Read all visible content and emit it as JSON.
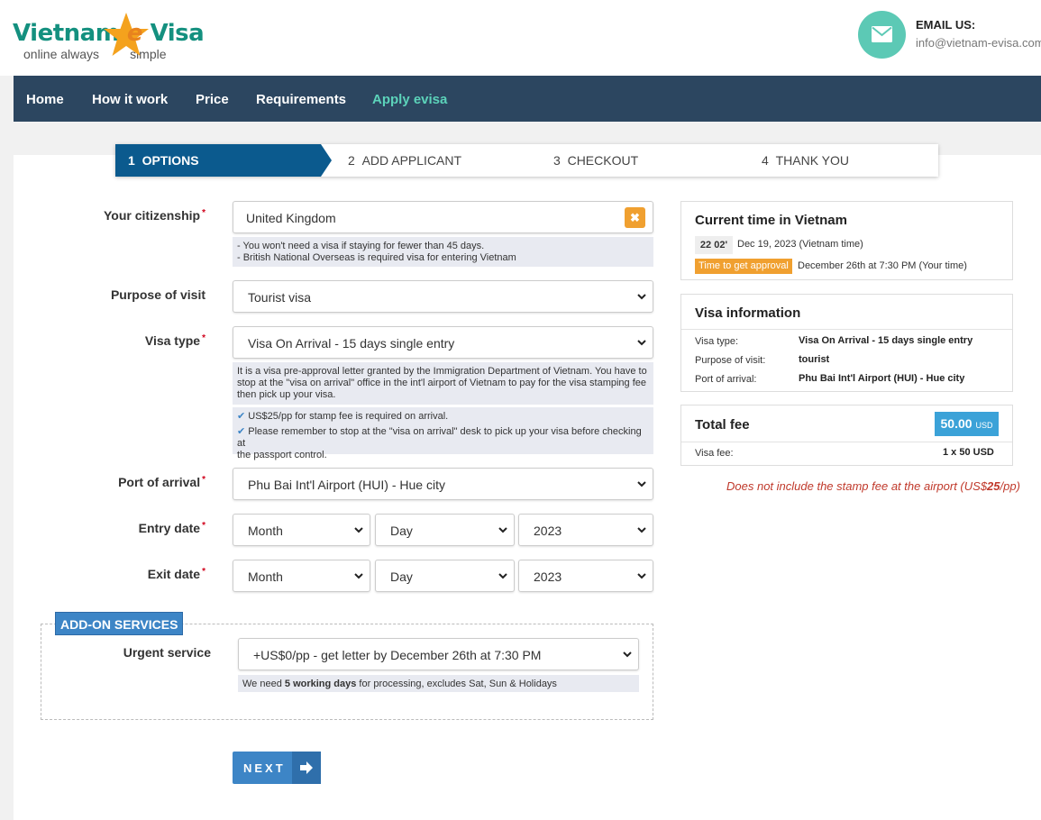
{
  "header": {
    "logo_word1": "Vietnam",
    "logo_e": "e",
    "logo_word2": "Visa",
    "logo_tag1": "online always",
    "logo_tag2": "simple",
    "email_label": "EMAIL US:",
    "email_value": "info@vietnam-evisa.com"
  },
  "nav": {
    "items": [
      "Home",
      "How it work",
      "Price",
      "Requirements",
      "Apply evisa"
    ],
    "active": "Apply evisa"
  },
  "steps": [
    {
      "num": "1",
      "label": "OPTIONS",
      "active": true
    },
    {
      "num": "2",
      "label": "ADD APPLICANT"
    },
    {
      "num": "3",
      "label": "CHECKOUT"
    },
    {
      "num": "4",
      "label": "THANK YOU"
    }
  ],
  "form": {
    "citizenship_label": "Your citizenship",
    "citizenship_value": "United Kingdom",
    "citizenship_note1": "- You won't need a visa if staying for fewer than 45 days.",
    "citizenship_note2": "- British National Overseas is required visa for entering Vietnam",
    "purpose_label": "Purpose of visit",
    "purpose_value": "Tourist visa",
    "visa_type_label": "Visa type",
    "visa_type_value": "Visa On Arrival - 15 days single entry",
    "visa_note1": "It is a visa pre-approval letter granted by the Immigration Department of Vietnam. You have to",
    "visa_note2": "stop at the \"visa on arrival\" office in the int'l airport of Vietnam to pay for the visa stamping fee",
    "visa_note3": "then pick up your visa.",
    "check1": "US$25/pp for stamp fee is required on arrival.",
    "check2a": "Please remember to stop at the \"visa on arrival\" desk to pick up your visa before checking at",
    "check2b": "the passport control.",
    "port_label": "Port of arrival",
    "port_value": "Phu Bai Int'l Airport (HUI) - Hue city",
    "entry_label": "Entry date",
    "exit_label": "Exit date",
    "month": "Month",
    "day": "Day",
    "year": "2023"
  },
  "addon": {
    "badge": "ADD-ON SERVICES",
    "urgent_label": "Urgent service",
    "urgent_value": "+US$0/pp - get letter by December 26th at 7:30 PM",
    "note_pre": "We need ",
    "note_bold": "5 working days",
    "note_post": " for processing, excludes Sat, Sun & Holidays"
  },
  "next_label": "NEXT",
  "current_time": {
    "title": "Current time in Vietnam",
    "clock": "22 02'",
    "date": "Dec 19, 2023 (Vietnam time)",
    "approval_badge": "Time to get approval",
    "approval_date": "December 26th at 7:30 PM (Your time)"
  },
  "visa_info": {
    "title": "Visa information",
    "rows": [
      {
        "label": "Visa type:",
        "value": "Visa On Arrival - 15 days single entry"
      },
      {
        "label": "Purpose of visit:",
        "value": "tourist"
      },
      {
        "label": "Port of arrival:",
        "value": "Phu Bai Int'l Airport (HUI) - Hue city"
      }
    ]
  },
  "fee": {
    "title": "Total fee",
    "amount": "50.00",
    "currency": "USD",
    "row_label": "Visa fee:",
    "row_value": "1 x 50 USD",
    "stamp_pre": "Does not include the stamp fee at the airport (US$",
    "stamp_bold": "25",
    "stamp_post": "/pp)"
  },
  "colors": {
    "nav_bg": "#2c4660",
    "accent_teal": "#5cd3ba",
    "step_active": "#0b5a8e",
    "button_blue": "#3d85c6",
    "orange": "#f0a030"
  }
}
